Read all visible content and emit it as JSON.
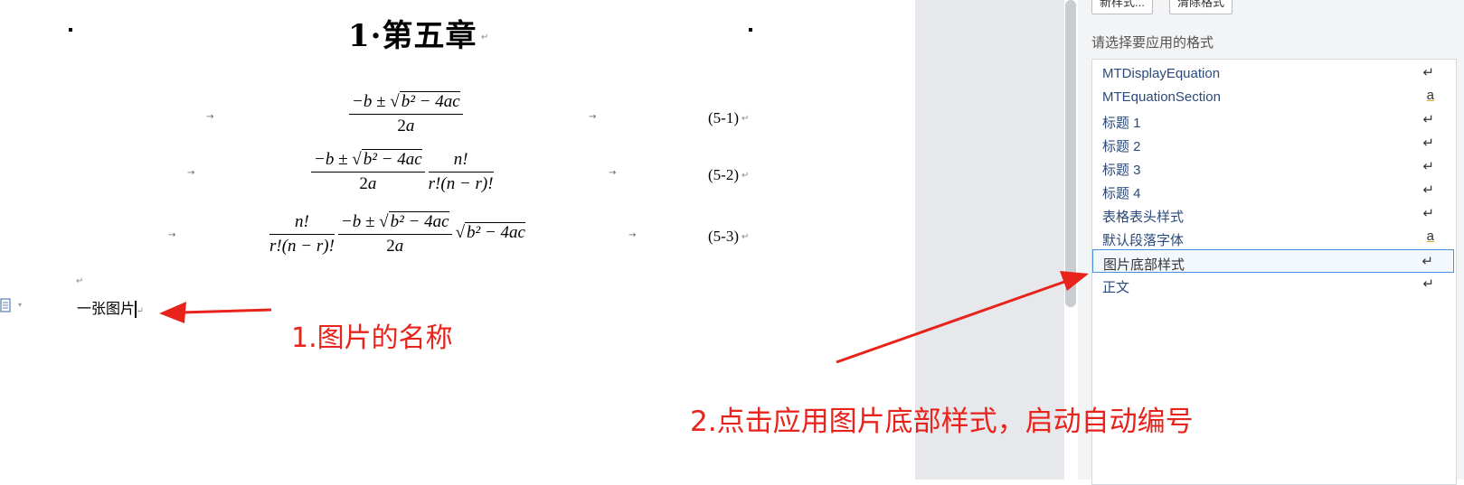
{
  "document": {
    "chapter_heading": "1·第五章",
    "equations": [
      {
        "number": "(5-1)"
      },
      {
        "number": "(5-2)"
      },
      {
        "number": "(5-3)"
      }
    ],
    "caption_text": "一张图片",
    "para_mark": "↵"
  },
  "styles_panel": {
    "new_style_button": "新样式...",
    "clear_format_button": "清除格式",
    "apply_label": "请选择要应用的格式",
    "items": [
      {
        "name": "MTDisplayEquation",
        "marker": "↵"
      },
      {
        "name": "MTEquationSection",
        "marker": "a"
      },
      {
        "name": "标题 1",
        "marker": "↵"
      },
      {
        "name": "标题 2",
        "marker": "↵"
      },
      {
        "name": "标题 3",
        "marker": "↵"
      },
      {
        "name": "标题 4",
        "marker": "↵"
      },
      {
        "name": "表格表头样式",
        "marker": "↵"
      },
      {
        "name": "默认段落字体",
        "marker": "a"
      },
      {
        "name": "图片底部样式",
        "marker": "↵",
        "selected": true
      },
      {
        "name": "正文",
        "marker": "↵"
      }
    ]
  },
  "annotations": {
    "step1": "1.图片的名称",
    "step2": "2.点击应用图片底部样式，启动自动编号"
  },
  "colors": {
    "annotation_red": "#e8231b",
    "selection_border": "#4a8fd8",
    "style_text": "#2b4a7a"
  }
}
